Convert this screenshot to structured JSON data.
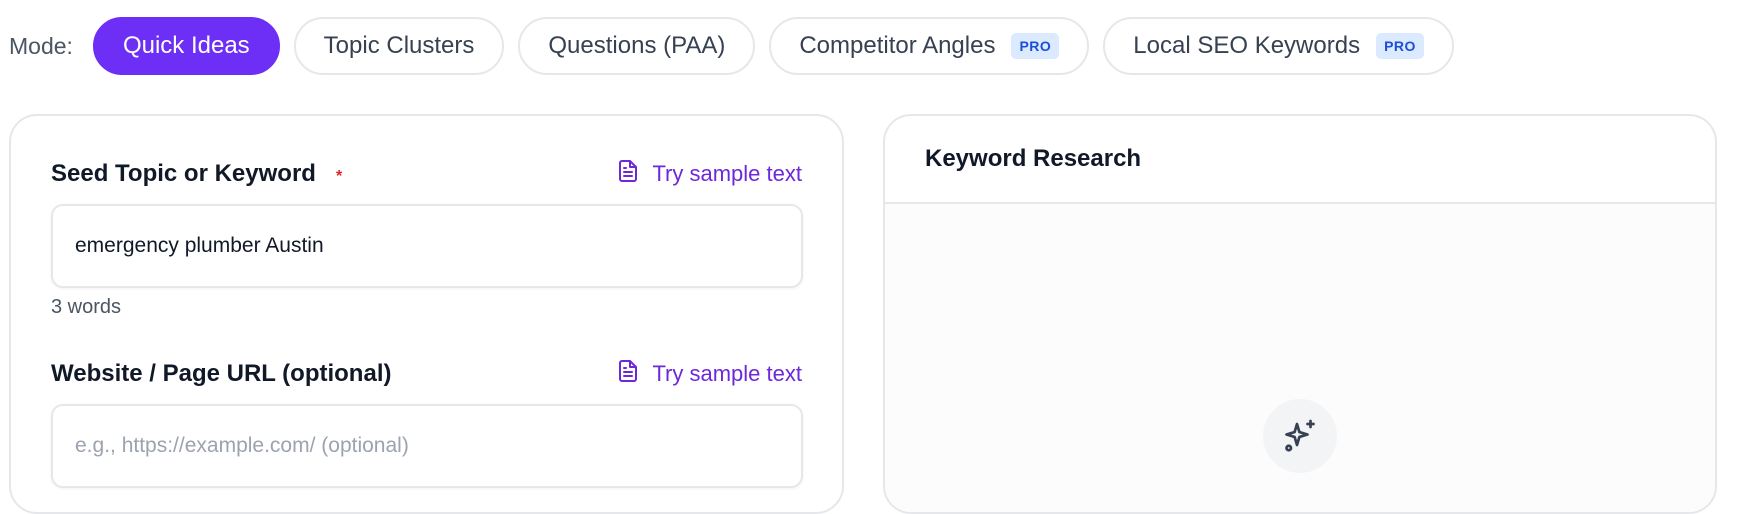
{
  "mode_bar": {
    "label": "Mode:",
    "modes": [
      {
        "label": "Quick Ideas",
        "active": true,
        "badge": ""
      },
      {
        "label": "Topic Clusters",
        "active": false,
        "badge": ""
      },
      {
        "label": "Questions (PAA)",
        "active": false,
        "badge": ""
      },
      {
        "label": "Competitor Angles",
        "active": false,
        "badge": "PRO"
      },
      {
        "label": "Local SEO Keywords",
        "active": false,
        "badge": "PRO"
      }
    ]
  },
  "form": {
    "seed": {
      "label": "Seed Topic or Keyword",
      "required_mark": "*",
      "sample_link": "Try sample text",
      "value": "emergency plumber Austin",
      "word_count": "3 words"
    },
    "url": {
      "label": "Website / Page URL (optional)",
      "sample_link": "Try sample text",
      "value": "",
      "placeholder": "e.g., https://example.com/ (optional)"
    }
  },
  "results_panel": {
    "title": "Keyword Research",
    "empty_icon": "sparkles-icon"
  },
  "colors": {
    "accent": "#6d2ef5",
    "link": "#6d28d9",
    "required": "#dc2626",
    "pro_badge_bg": "#dbeafe",
    "pro_badge_text": "#1d4ed8"
  }
}
